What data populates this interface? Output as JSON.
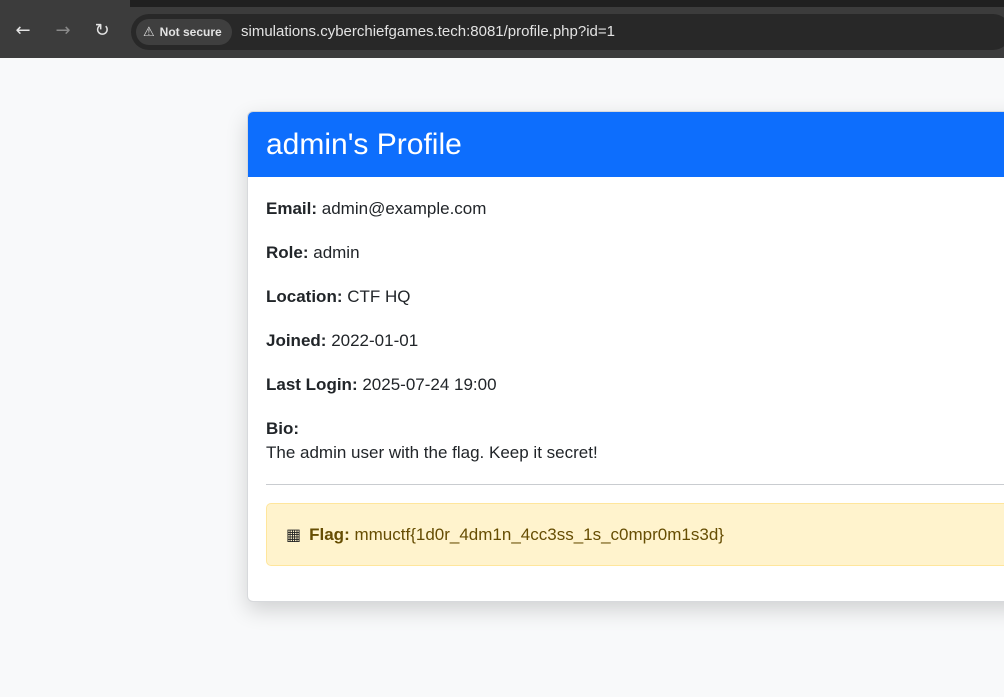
{
  "browser": {
    "security_label": "Not secure",
    "url": "simulations.cyberchiefgames.tech:8081/profile.php?id=1"
  },
  "profile": {
    "title": "admin's Profile",
    "fields": [
      {
        "label": "Email:",
        "value": "admin@example.com"
      },
      {
        "label": "Role:",
        "value": "admin"
      },
      {
        "label": "Location:",
        "value": "CTF HQ"
      },
      {
        "label": "Joined:",
        "value": "2022-01-01"
      },
      {
        "label": "Last Login:",
        "value": "2025-07-24 19:00"
      }
    ],
    "bio_label": "Bio:",
    "bio_text": "The admin user with the flag. Keep it secret!",
    "flag": {
      "icon": "checkered-flag-icon",
      "label": "Flag:",
      "value": "mmuctf{1d0r_4dm1n_4cc3ss_1s_c0mpr0m1s3d}"
    }
  }
}
